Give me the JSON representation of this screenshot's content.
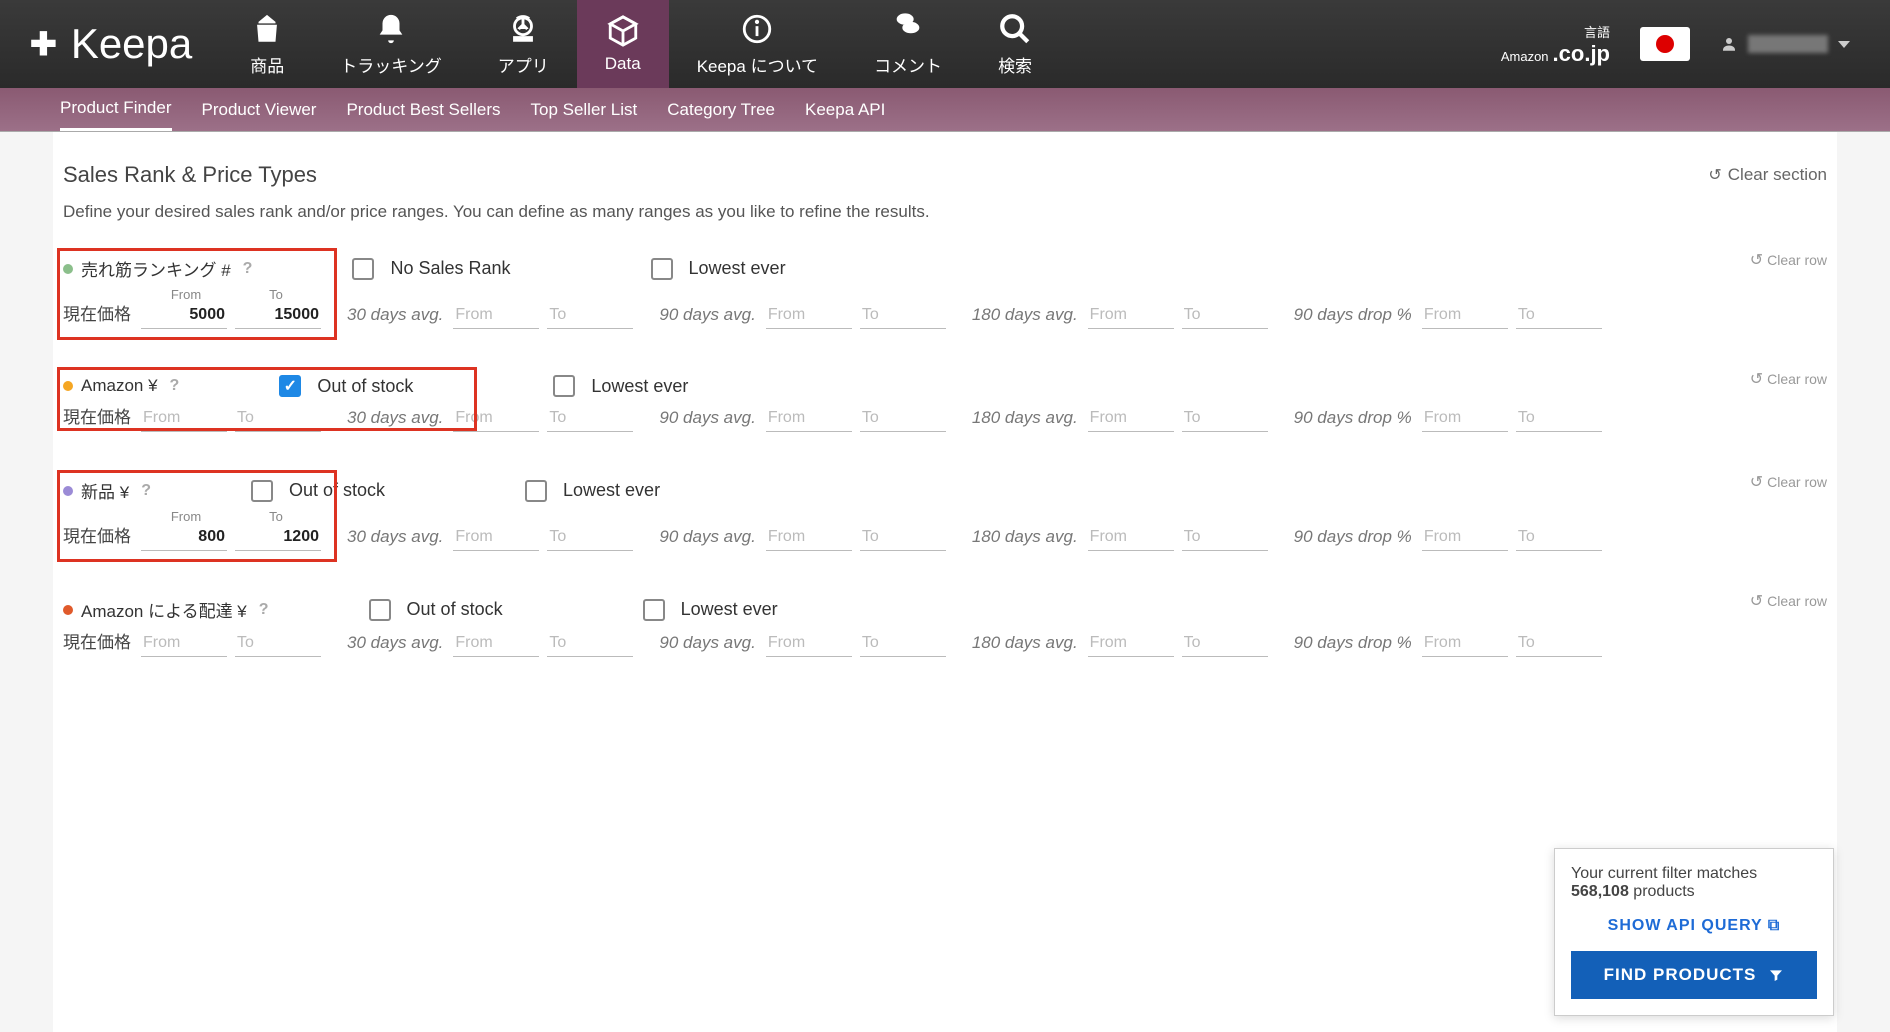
{
  "topnav": {
    "logo": "Keepa",
    "items": [
      {
        "label": "商品"
      },
      {
        "label": "トラッキング"
      },
      {
        "label": "アプリ"
      },
      {
        "label": "Data",
        "active": true
      },
      {
        "label": "Keepa について"
      },
      {
        "label": "コメント"
      },
      {
        "label": "検索"
      }
    ],
    "lang_label": "言語",
    "amazon_label": "Amazon",
    "domain": ".co.jp"
  },
  "subnav": {
    "tabs": [
      {
        "label": "Product Finder",
        "active": true
      },
      {
        "label": "Product Viewer"
      },
      {
        "label": "Product Best Sellers"
      },
      {
        "label": "Top Seller List"
      },
      {
        "label": "Category Tree"
      },
      {
        "label": "Keepa API"
      }
    ]
  },
  "section": {
    "title": "Sales Rank & Price Types",
    "clear": "Clear section",
    "desc": "Define your desired sales rank and/or price ranges. You can define as many ranges as you like to refine the results."
  },
  "labels": {
    "from": "From",
    "to": "To",
    "current": "現在価格",
    "avg30": "30 days avg.",
    "avg90": "90 days avg.",
    "avg180": "180 days avg.",
    "drop90": "90 days drop %",
    "clear_row": "Clear row",
    "no_sales_rank": "No Sales Rank",
    "out_of_stock": "Out of stock",
    "lowest_ever": "Lowest ever",
    "help": "?"
  },
  "rows": [
    {
      "id": "salesrank",
      "title": "売れ筋ランキング #",
      "bullet": "b-green",
      "chk1_label_key": "no_sales_rank",
      "chk1_checked": false,
      "show_from_to_labels": true,
      "current_from": "5000",
      "current_to": "15000",
      "redbox": true
    },
    {
      "id": "amazon",
      "title": "Amazon ¥",
      "bullet": "b-orange",
      "chk1_label_key": "out_of_stock",
      "chk1_checked": true,
      "show_from_to_labels": false,
      "current_from": "",
      "current_to": "",
      "redbox": true,
      "redbox_wide": true
    },
    {
      "id": "new",
      "title": "新品 ¥",
      "bullet": "b-purple",
      "chk1_label_key": "out_of_stock",
      "chk1_checked": false,
      "show_from_to_labels": true,
      "current_from": "800",
      "current_to": "1200",
      "redbox": true
    },
    {
      "id": "amazon-ship",
      "title": "Amazon による配達 ¥",
      "bullet": "b-red",
      "chk1_label_key": "out_of_stock",
      "chk1_checked": false,
      "show_from_to_labels": false,
      "current_from": "",
      "current_to": "",
      "redbox": false
    }
  ],
  "panel": {
    "text1": "Your current filter matches",
    "count": "568,108",
    "text2": "products",
    "api": "SHOW API QUERY",
    "find": "FIND PRODUCTS"
  }
}
